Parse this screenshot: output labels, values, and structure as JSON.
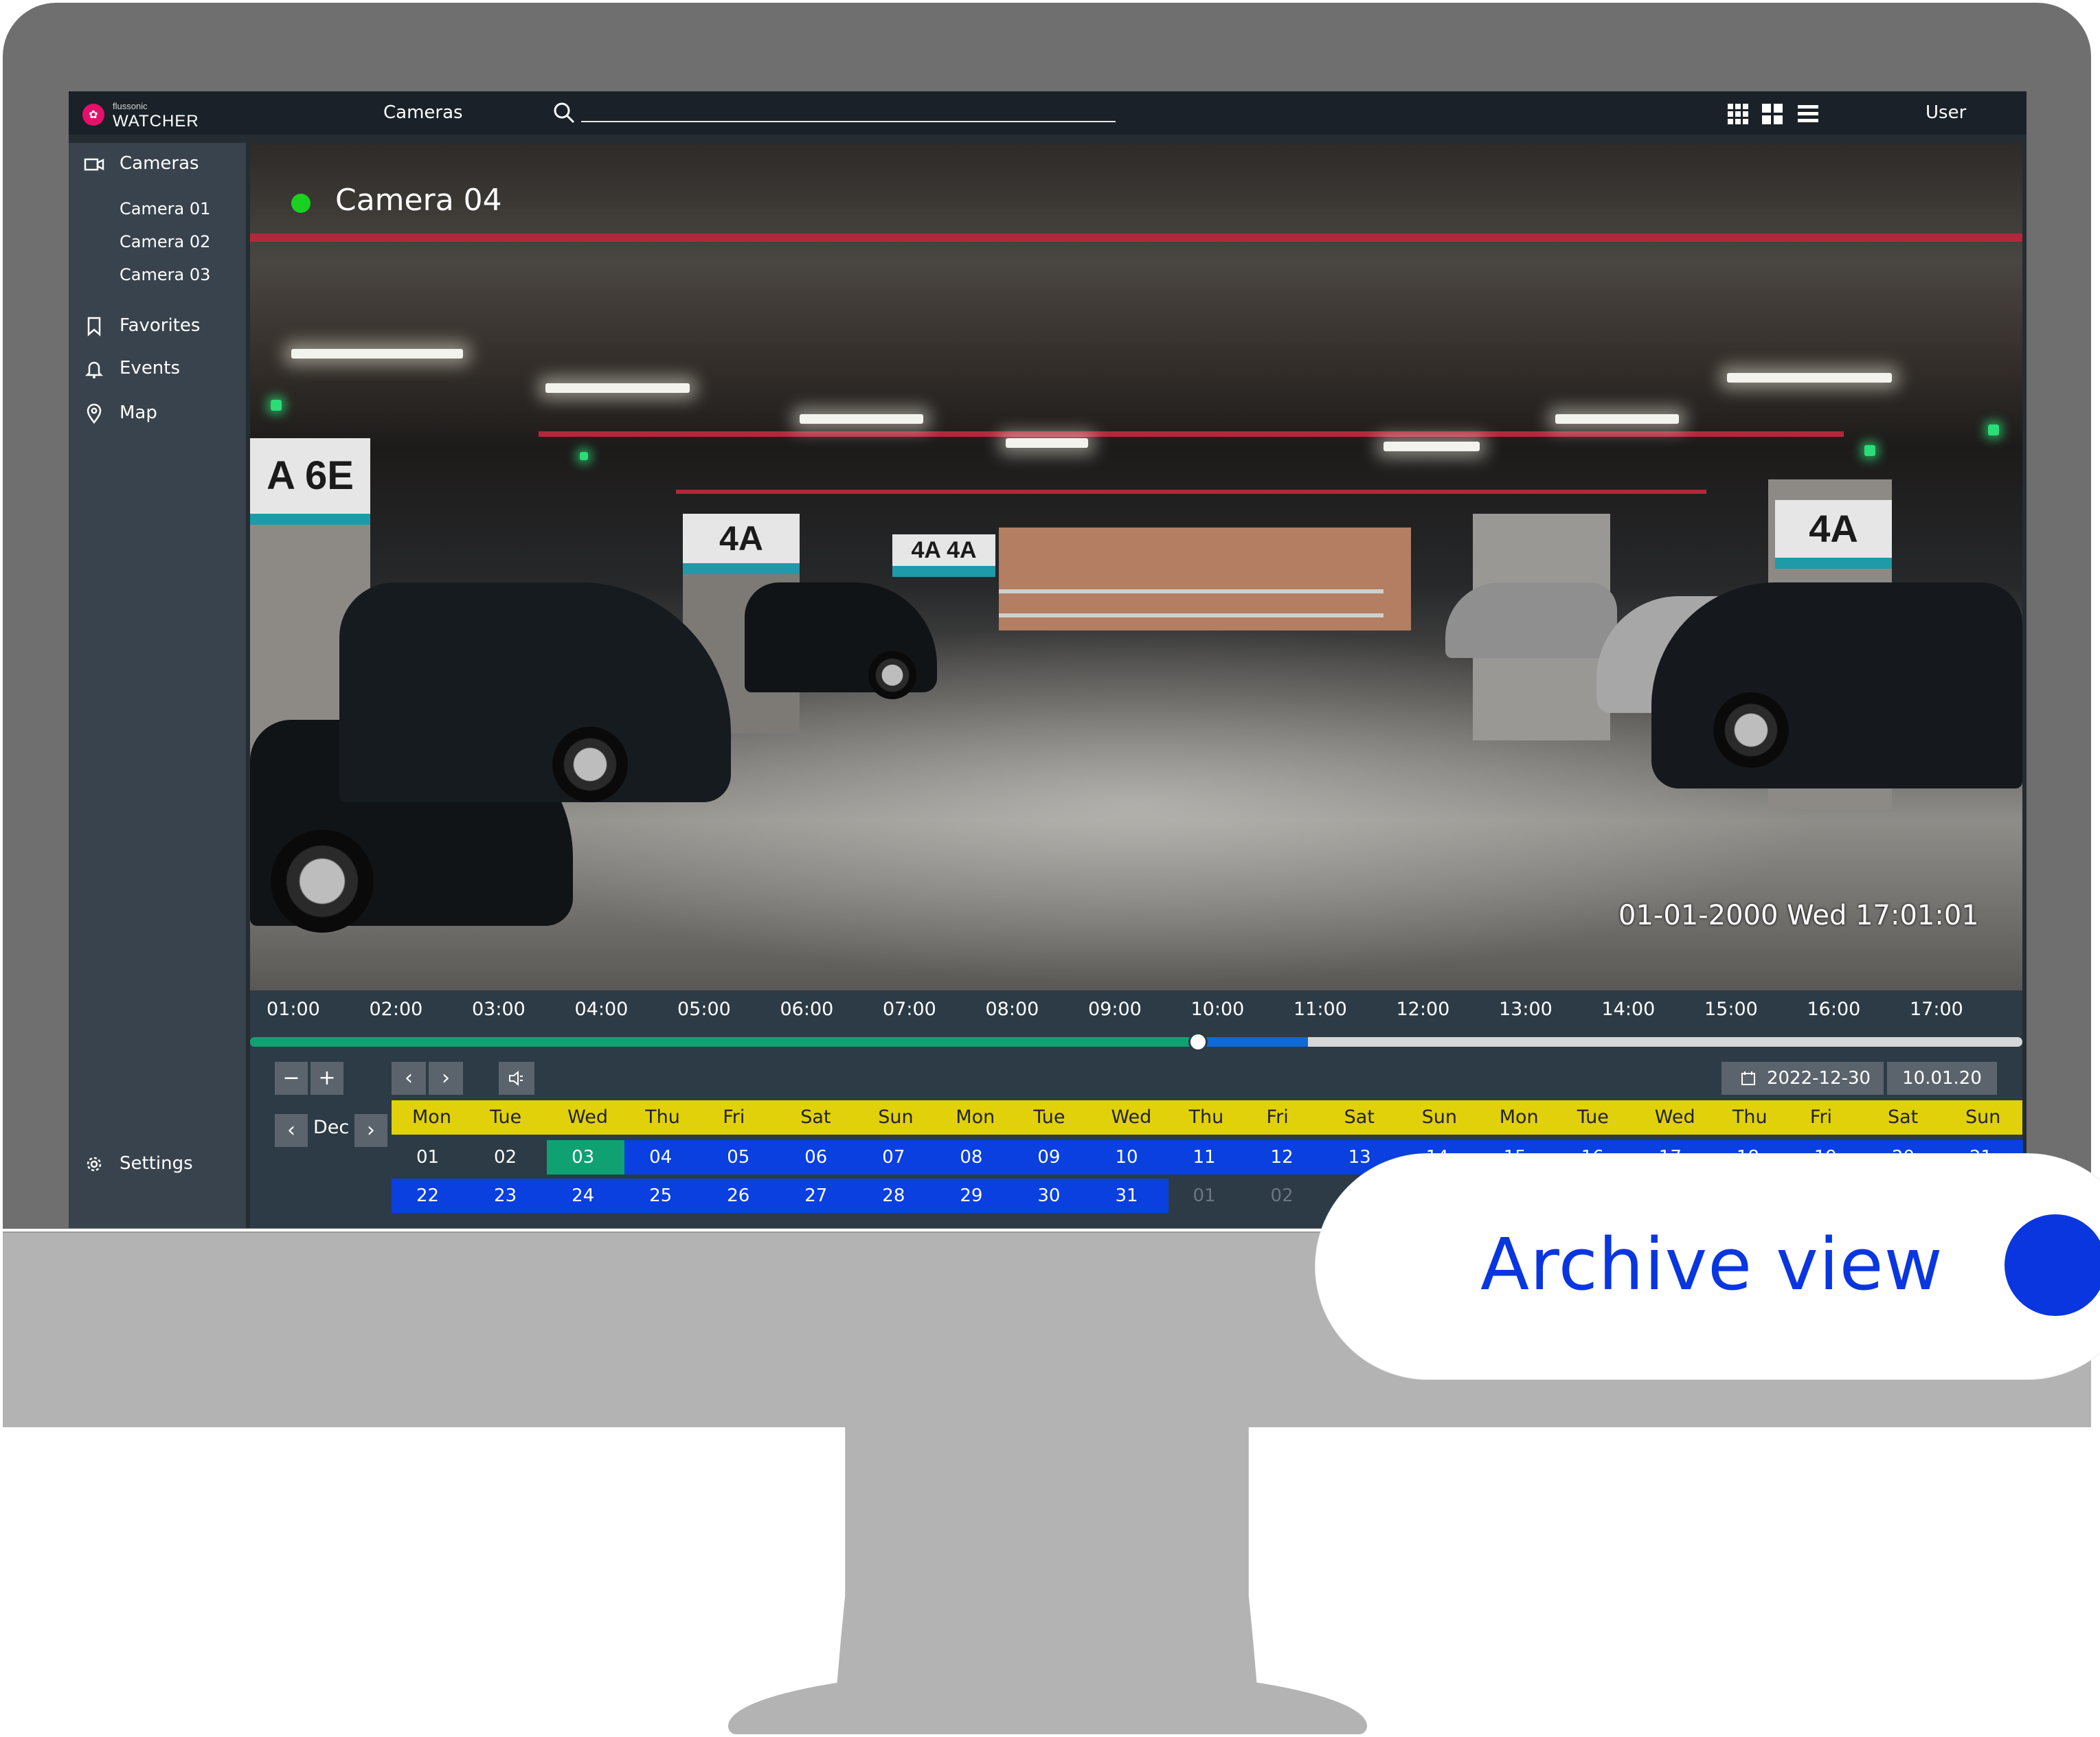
{
  "app": {
    "logo_small": "flussonic",
    "logo_name": "WATCHER",
    "title": "Cameras",
    "user": "User",
    "search": {
      "placeholder": ""
    }
  },
  "sidebar": {
    "cameras_label": "Cameras",
    "cameras": [
      "Camera 01",
      "Camera 02",
      "Camera 03"
    ],
    "favorites_label": "Favorites",
    "events_label": "Events",
    "map_label": "Map",
    "settings_label": "Settings"
  },
  "player": {
    "camera_name": "Camera 04",
    "status_color": "#19d120",
    "timestamp": "01-01-2000 Wed 17:01:01"
  },
  "timeline": {
    "ticks": [
      "01:00",
      "02:00",
      "03:00",
      "04:00",
      "05:00",
      "06:00",
      "07:00",
      "08:00",
      "09:00",
      "10:00",
      "11:00",
      "12:00",
      "13:00",
      "14:00",
      "15:00",
      "16:00",
      "17:00"
    ],
    "recorded_until_fraction": 0.537,
    "buffered_until_fraction": 0.597,
    "playhead_fraction": 0.535,
    "colors": {
      "recorded": "#0fa172",
      "buffered": "#0e6ad6",
      "track": "#d7d7d7"
    }
  },
  "controls": {
    "zoom_out": "−",
    "zoom_in": "+",
    "prev": "‹",
    "next": "›",
    "date": "2022-12-30",
    "time": "10.01.20"
  },
  "calendar": {
    "month": "Dec",
    "weekdays": [
      "Mon",
      "Tue",
      "Wed",
      "Thu",
      "Fri",
      "Sat",
      "Sun",
      "Mon",
      "Tue",
      "Wed",
      "Thu",
      "Fri",
      "Sat",
      "Sun",
      "Mon",
      "Tue",
      "Wed",
      "Thu",
      "Fri",
      "Sat",
      "Sun"
    ],
    "row1": [
      "01",
      "02",
      "03",
      "04",
      "05",
      "06",
      "07",
      "08",
      "09",
      "10",
      "11",
      "12",
      "13",
      "14",
      "15",
      "16",
      "17",
      "18",
      "19",
      "20",
      "21"
    ],
    "row2": [
      "22",
      "23",
      "24",
      "25",
      "26",
      "27",
      "28",
      "29",
      "30",
      "31",
      "01",
      "02"
    ],
    "selected_day": "03",
    "colors": {
      "weekday_bar": "#e0d10b",
      "has_archive": "#0a3fe0",
      "selected": "#0fa172"
    }
  },
  "badge": {
    "label": "Archive view",
    "color": "#0a36e0"
  }
}
